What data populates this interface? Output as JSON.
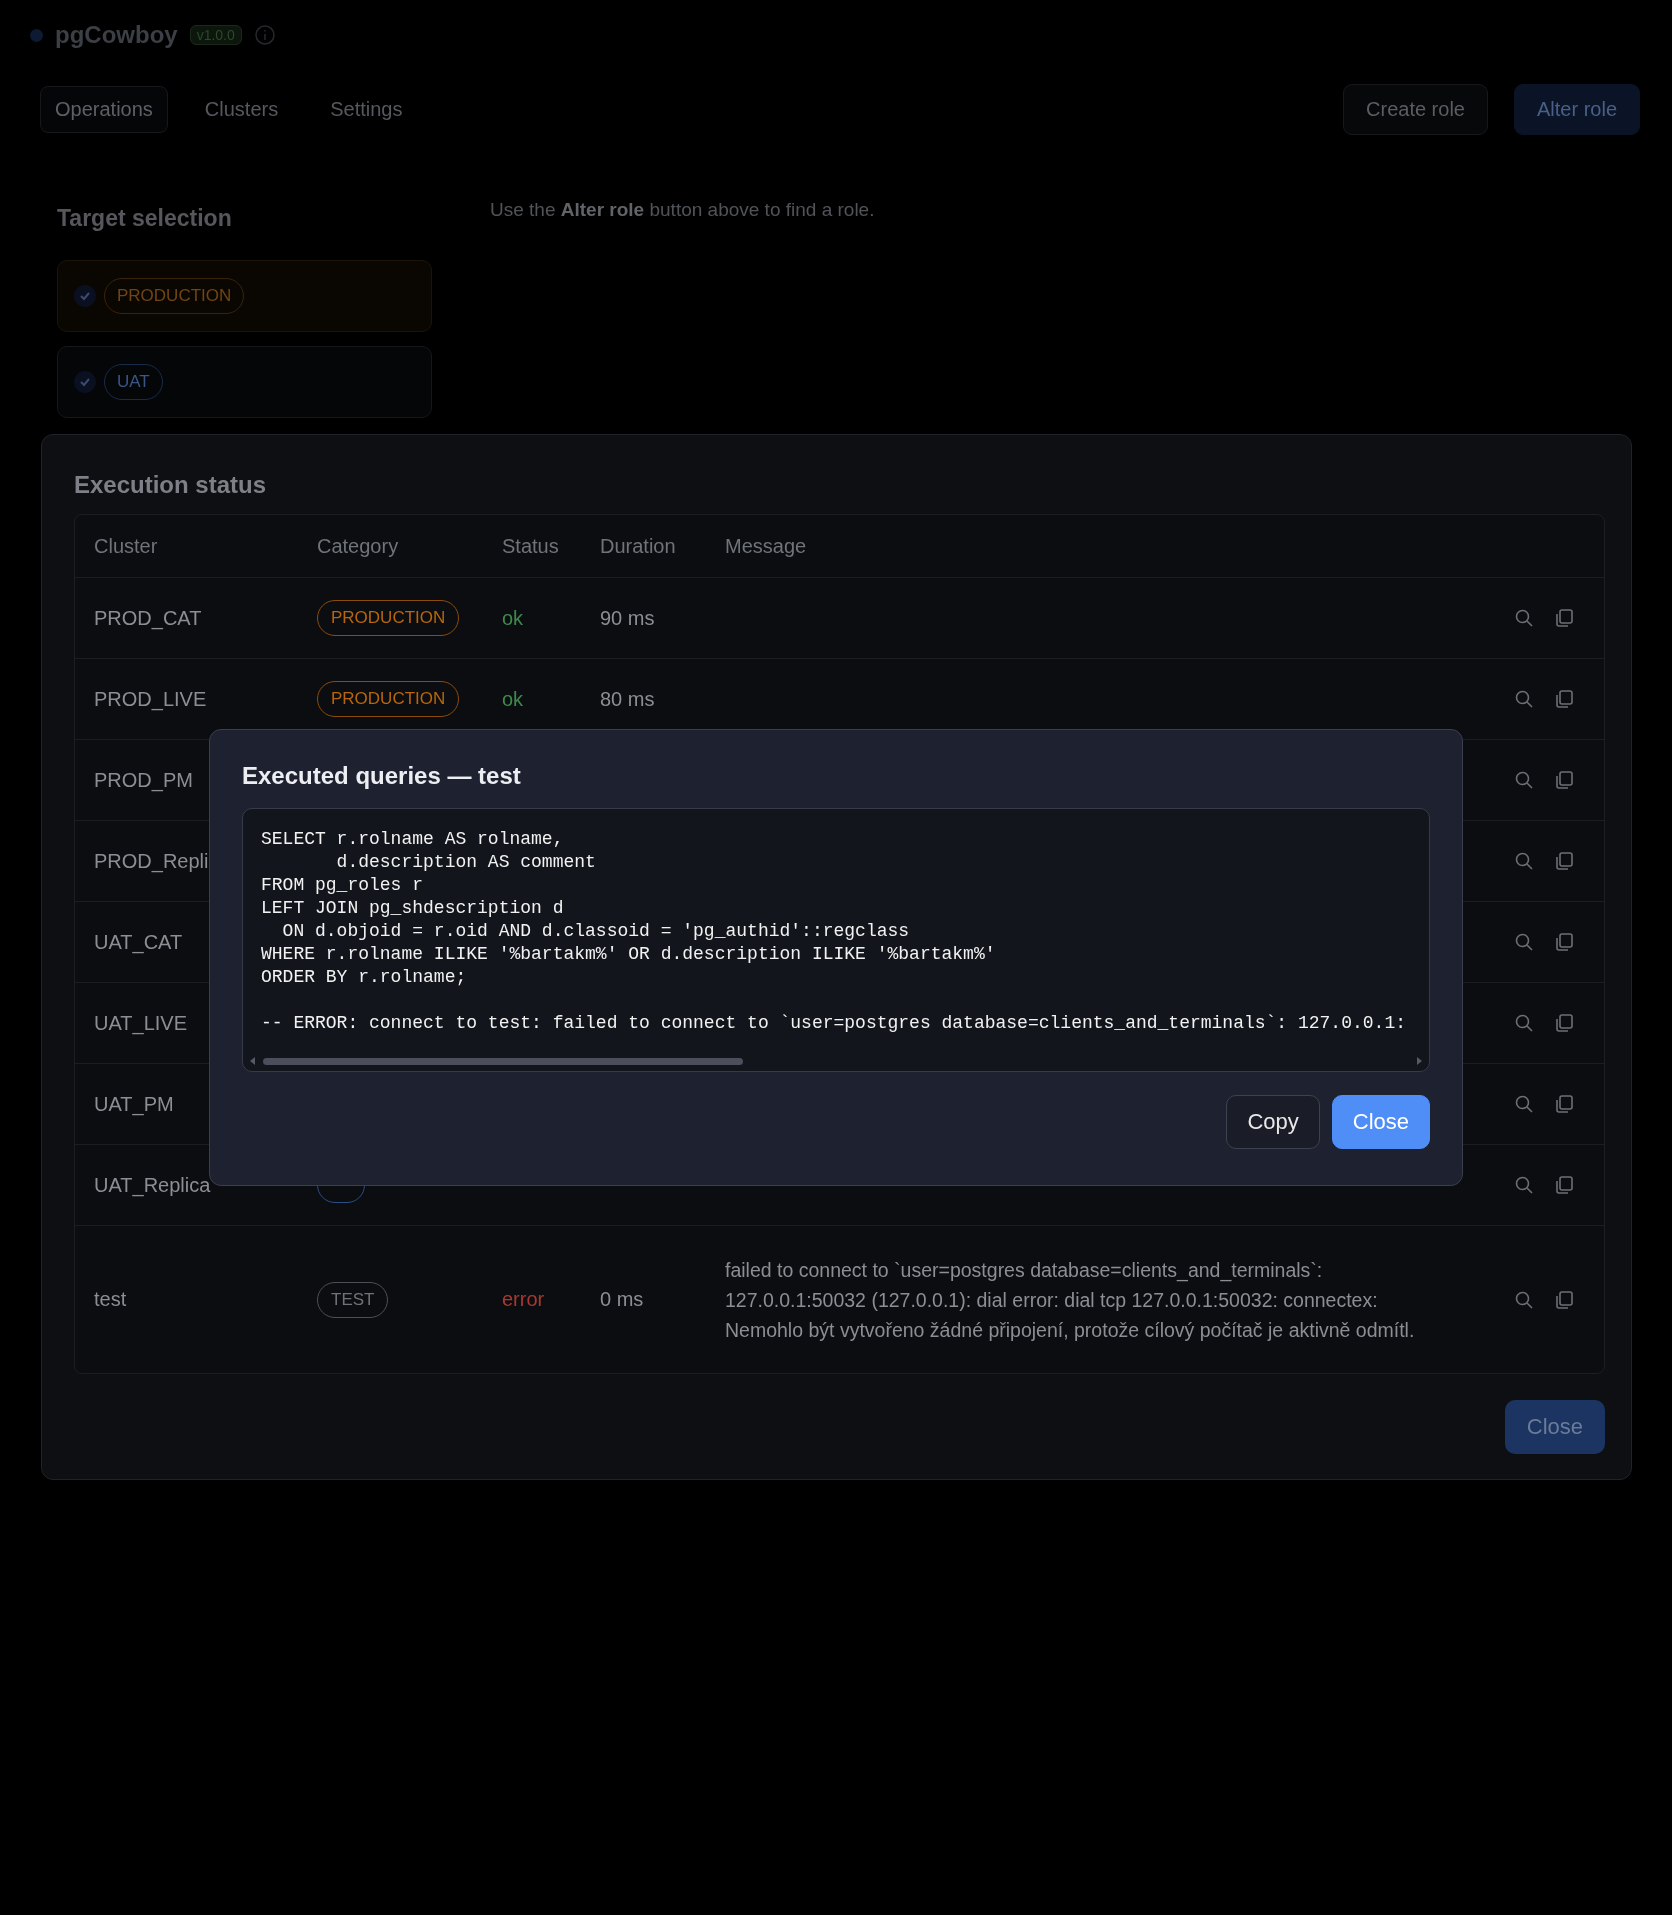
{
  "app": {
    "name": "pgCowboy",
    "version": "v1.0.0"
  },
  "tabs": [
    {
      "label": "Operations",
      "selected": true
    },
    {
      "label": "Clusters",
      "selected": false
    },
    {
      "label": "Settings",
      "selected": false
    }
  ],
  "actions": [
    {
      "label": "Create role",
      "kind": "secondary"
    },
    {
      "label": "Alter role",
      "kind": "primary"
    }
  ],
  "target_selection": {
    "title": "Target selection",
    "items": [
      {
        "category": "PRODUCTION",
        "kind": "production",
        "checked": true
      },
      {
        "category": "UAT",
        "kind": "uat",
        "checked": true
      }
    ]
  },
  "hint": "Use the **Alter role** button above to find a role.",
  "execution_status": {
    "title": "Execution status",
    "columns": [
      "Cluster",
      "Category",
      "Status",
      "Duration",
      "Message"
    ],
    "rows": [
      {
        "cluster": "PROD_CAT",
        "category": {
          "label": "PRODUCTION",
          "kind": "production"
        },
        "status": {
          "label": "ok",
          "kind": "ok"
        },
        "duration": "90 ms"
      },
      {
        "cluster": "PROD_LIVE",
        "category": {
          "label": "PRODUCTION",
          "kind": "production"
        },
        "status": {
          "label": "ok",
          "kind": "ok"
        },
        "duration": "80 ms"
      },
      {
        "cluster": "PROD_PM"
      },
      {
        "cluster": "PROD_Repli"
      },
      {
        "cluster": "UAT_CAT"
      },
      {
        "cluster": "UAT_LIVE"
      },
      {
        "cluster": "UAT_PM"
      },
      {
        "cluster": "UAT_Replica",
        "category": {
          "kind": "uat"
        }
      },
      {
        "cluster": "test",
        "category": {
          "label": "TEST",
          "kind": "test"
        },
        "status": {
          "label": "error",
          "kind": "error"
        },
        "duration": "0 ms",
        "message": "failed to connect to `user=postgres database=clients_and_terminals`: 127.0.0.1:50032 (127.0.0.1): dial error: dial tcp 127.0.0.1:50032: connectex: Nemohlo být vytvořeno žádné připojení, protože cílový počítač je aktivně odmítl."
      }
    ],
    "close_button": "Close"
  },
  "query_dialog": {
    "title": "Executed queries — test",
    "code": "SELECT r.rolname AS rolname,\n       d.description AS comment\nFROM pg_roles r\nLEFT JOIN pg_shdescription d\n  ON d.objoid = r.oid AND d.classoid = 'pg_authid'::regclass\nWHERE r.rolname ILIKE '%bartakm%' OR d.description ILIKE '%bartakm%'\nORDER BY r.rolname;\n\n-- ERROR: connect to test: failed to connect to `user=postgres database=clients_and_terminals`: 127.0.0.1:",
    "buttons": [
      {
        "label": "Copy",
        "kind": "secondary"
      },
      {
        "label": "Close",
        "kind": "primary"
      }
    ]
  }
}
